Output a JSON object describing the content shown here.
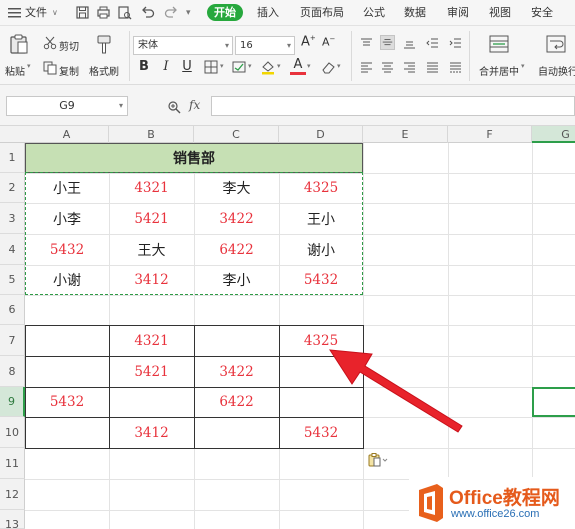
{
  "menubar": {
    "file_label": "文件",
    "start_label": "开始",
    "insert_label": "插入",
    "page_layout_label": "页面布局",
    "formula_label": "公式",
    "data_label": "数据",
    "review_label": "审阅",
    "view_label": "视图",
    "security_label": "安全"
  },
  "ribbon": {
    "paste_label": "粘贴",
    "cut_label": "剪切",
    "copy_label": "复制",
    "format_painter_label": "格式刷",
    "font_name": "宋体",
    "font_size": "16",
    "merge_center_label": "合并居中",
    "wrap_text_label": "自动换行"
  },
  "formula_bar": {
    "name_box": "G9",
    "fx_label": "fx",
    "formula": ""
  },
  "grid": {
    "columns": [
      "A",
      "B",
      "C",
      "D",
      "E",
      "F",
      "G"
    ],
    "rows": [
      "1",
      "2",
      "3",
      "4",
      "5",
      "6",
      "7",
      "8",
      "9",
      "10",
      "11",
      "12",
      "13"
    ],
    "title": "销售部",
    "table1": [
      [
        "小王",
        "4321",
        "李大",
        "4325"
      ],
      [
        "小李",
        "5421",
        "3422",
        "王小"
      ],
      [
        "5432",
        "王大",
        "6422",
        "谢小"
      ],
      [
        "小谢",
        "3412",
        "李小",
        "5432"
      ]
    ],
    "table2": [
      [
        "",
        "4321",
        "",
        "4325"
      ],
      [
        "",
        "5421",
        "3422",
        ""
      ],
      [
        "5432",
        "",
        "6422",
        ""
      ],
      [
        "",
        "3412",
        "",
        "5432"
      ]
    ]
  },
  "colors": {
    "accent": "#27a83d",
    "number_red": "#e8323c",
    "header_fill": "#c6e0b4",
    "arrow_red": "#e8232b"
  },
  "logo": {
    "line1": "Office教程网",
    "line2": "www.office26.com"
  }
}
